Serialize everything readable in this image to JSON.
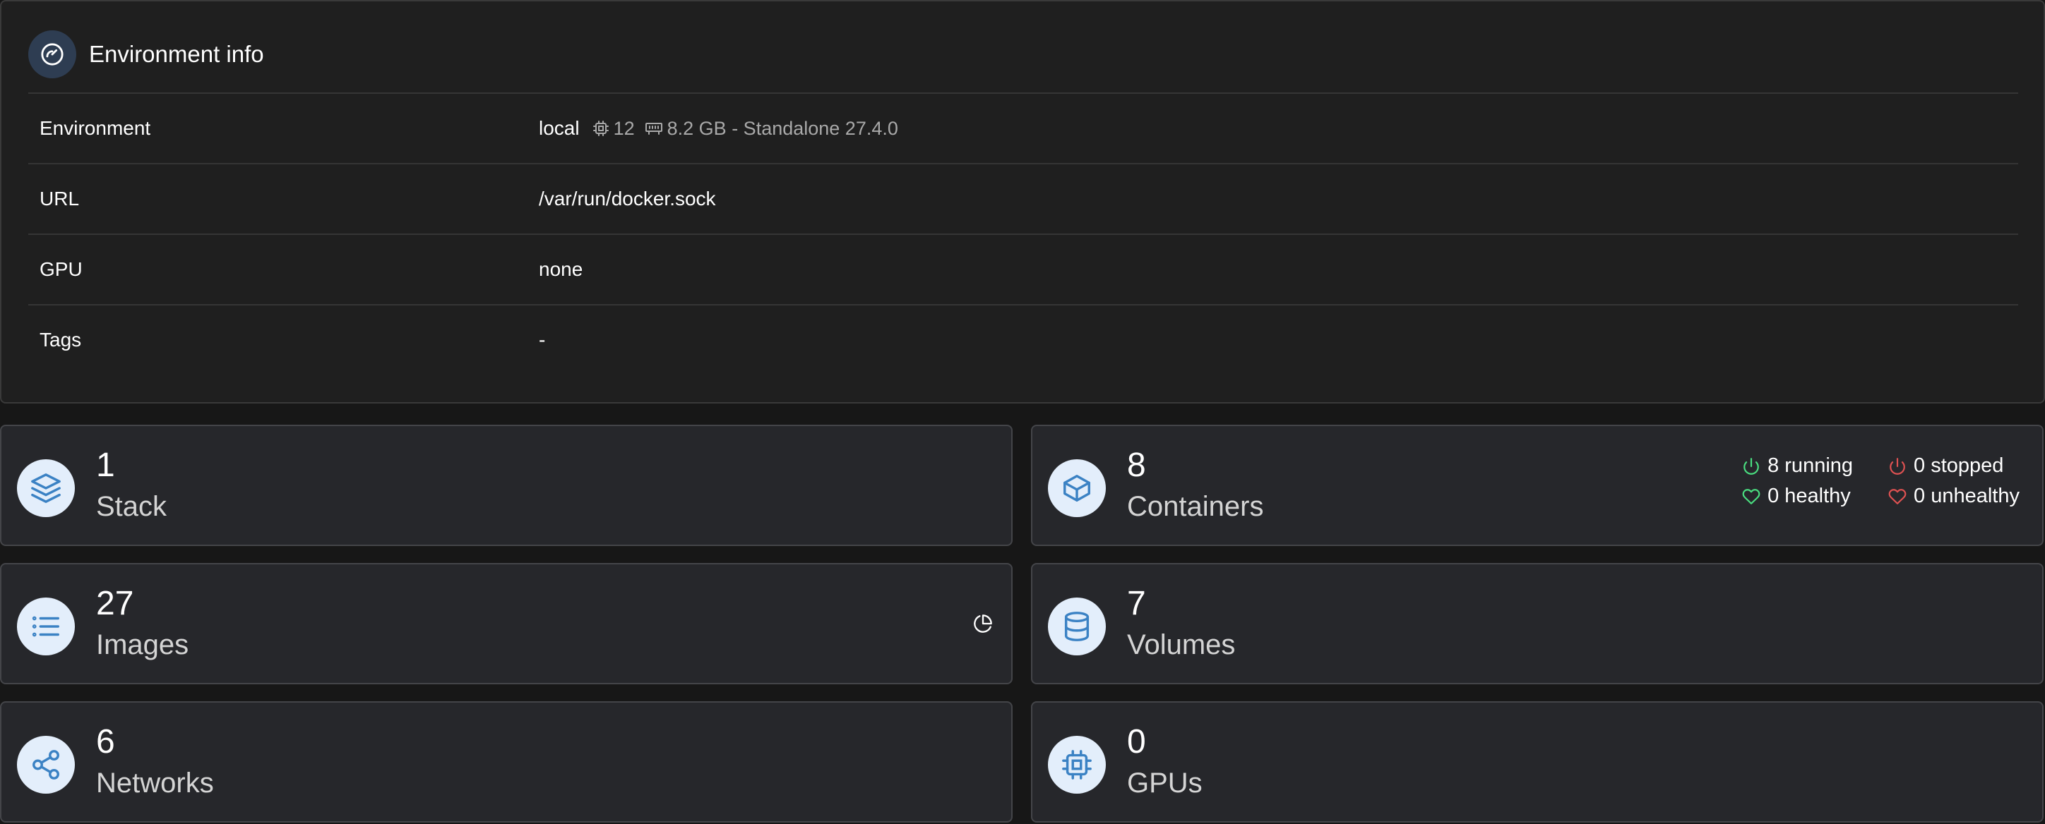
{
  "env_info": {
    "title": "Environment info",
    "header_icon": "gauge-icon",
    "rows": [
      {
        "label": "Environment",
        "value": "local"
      },
      {
        "label": "URL",
        "value": "/var/run/docker.sock"
      },
      {
        "label": "GPU",
        "value": "none"
      },
      {
        "label": "Tags",
        "value": "-"
      }
    ],
    "environment_meta": {
      "cpu_icon": "cpu-icon",
      "cpu": "12",
      "memory_icon": "memory-icon",
      "memory": "8.2 GB - Standalone 27.4.0"
    }
  },
  "cards": {
    "stack": {
      "value": "1",
      "label": "Stack",
      "icon": "layers-icon"
    },
    "containers": {
      "value": "8",
      "label": "Containers",
      "icon": "box-icon"
    },
    "images": {
      "value": "27",
      "label": "Images",
      "icon": "list-icon"
    },
    "volumes": {
      "value": "7",
      "label": "Volumes",
      "icon": "database-icon"
    },
    "networks": {
      "value": "6",
      "label": "Networks",
      "icon": "share-icon"
    },
    "gpus": {
      "value": "0",
      "label": "GPUs",
      "icon": "chip-icon"
    }
  },
  "container_stats": {
    "running": "8 running",
    "stopped": "0 stopped",
    "healthy": "0 healthy",
    "unhealthy": "0 unhealthy"
  },
  "colors": {
    "accent_blue": "#3b82c4",
    "icon_bg": "#e3eefb",
    "success": "#4ade80",
    "danger": "#e05252"
  }
}
